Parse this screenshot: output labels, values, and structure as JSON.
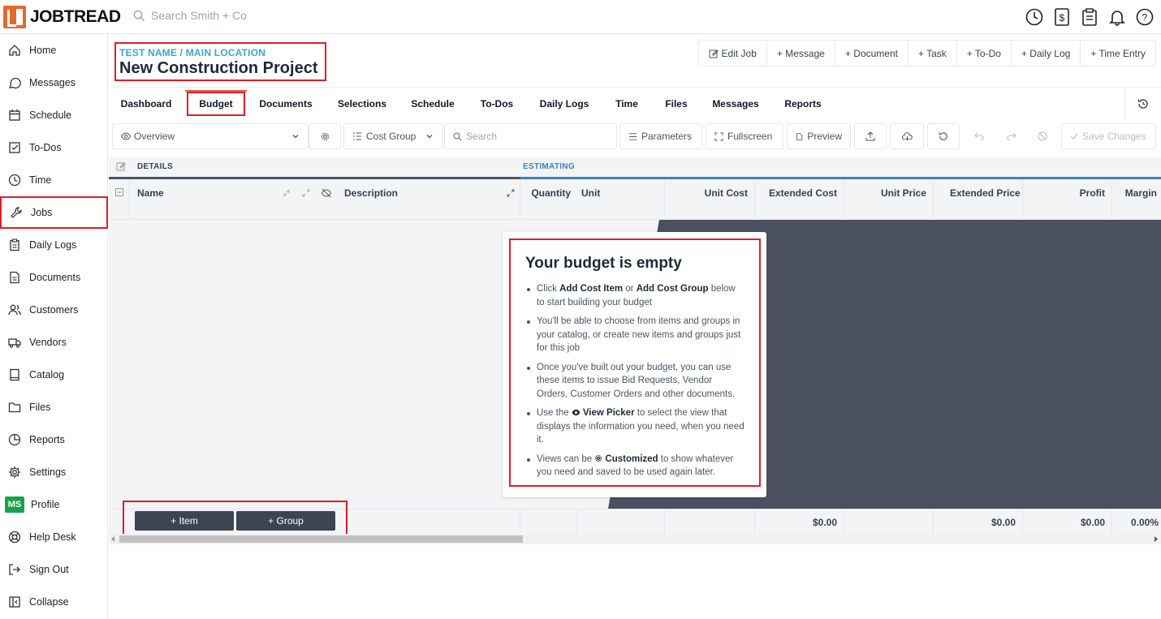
{
  "topbar": {
    "logo_text_bold": "JOBTREAD",
    "search_placeholder": "Search Smith + Co",
    "icons": [
      "clock-icon",
      "invoice-icon",
      "clipboard-icon",
      "bell-icon",
      "help-icon"
    ]
  },
  "sidebar": {
    "items": [
      {
        "label": "Home",
        "icon": "home-icon"
      },
      {
        "label": "Messages",
        "icon": "message-icon"
      },
      {
        "label": "Schedule",
        "icon": "calendar-icon"
      },
      {
        "label": "To-Dos",
        "icon": "checkbox-icon"
      },
      {
        "label": "Time",
        "icon": "clock-icon"
      },
      {
        "label": "Jobs",
        "icon": "wrench-icon"
      },
      {
        "label": "Daily Logs",
        "icon": "clipboard-icon"
      },
      {
        "label": "Documents",
        "icon": "document-icon"
      },
      {
        "label": "Customers",
        "icon": "users-icon"
      },
      {
        "label": "Vendors",
        "icon": "truck-icon"
      },
      {
        "label": "Catalog",
        "icon": "book-icon"
      },
      {
        "label": "Files",
        "icon": "folder-icon"
      },
      {
        "label": "Reports",
        "icon": "pie-chart-icon"
      },
      {
        "label": "Settings",
        "icon": "gear-icon"
      },
      {
        "label": "Profile",
        "avatar": "MS"
      },
      {
        "label": "Help Desk",
        "icon": "lifebuoy-icon"
      },
      {
        "label": "Sign Out",
        "icon": "sign-out-icon"
      },
      {
        "label": "Collapse",
        "icon": "collapse-icon"
      }
    ],
    "active": "Jobs"
  },
  "job": {
    "subtitle": "TEST NAME / MAIN LOCATION",
    "title": "New Construction Project"
  },
  "actions": [
    "Edit Job",
    "+ Message",
    "+ Document",
    "+ Task",
    "+ To-Do",
    "+ Daily Log",
    "+ Time Entry"
  ],
  "tabs": [
    "Dashboard",
    "Budget",
    "Documents",
    "Selections",
    "Schedule",
    "To-Dos",
    "Daily Logs",
    "Time",
    "Files",
    "Messages",
    "Reports"
  ],
  "active_tab": "Budget",
  "toolbar": {
    "view": "Overview",
    "group_by": "Cost Group",
    "search_placeholder": "Search",
    "parameters": "Parameters",
    "fullscreen": "Fullscreen",
    "preview": "Preview",
    "save_changes": "Save Changes"
  },
  "grid": {
    "section_details": "DETAILS",
    "section_estimating": "ESTIMATING",
    "columns": [
      "Name",
      "Description",
      "Quantity",
      "Unit",
      "Unit Cost",
      "Extended Cost",
      "Unit Price",
      "Extended Price",
      "Profit",
      "Margin"
    ],
    "totals": {
      "extended_cost": "$0.00",
      "extended_price": "$0.00",
      "profit": "$0.00",
      "margin": "0.00%"
    }
  },
  "empty_state": {
    "title": "Your budget is empty",
    "b1_pre": "Click ",
    "b1_bold1": "Add Cost Item",
    "b1_mid": " or ",
    "b1_bold2": "Add Cost Group",
    "b1_post": " below to start building your budget",
    "b2": "You'll be able to choose from items and groups in your catalog, or create new items and groups just for this job",
    "b3": "Once you've built out your budget, you can use these items to issue Bid Requests, Vendor Orders, Customer Orders and other documents.",
    "b4_pre": "Use the ",
    "b4_bold": "View Picker",
    "b4_post": " to select the view that displays the information you need, when you need it.",
    "b5_pre": "Views can be ",
    "b5_bold": "Customized",
    "b5_post": " to show whatever you need and saved to be used again later."
  },
  "add_buttons": {
    "item": "+ Item",
    "group": "+ Group"
  },
  "colors": {
    "brand_orange": "#e4682b",
    "highlight_red": "#e11d2a",
    "accent_blue": "#3aa5d4",
    "dark_panel": "#4b5060"
  }
}
